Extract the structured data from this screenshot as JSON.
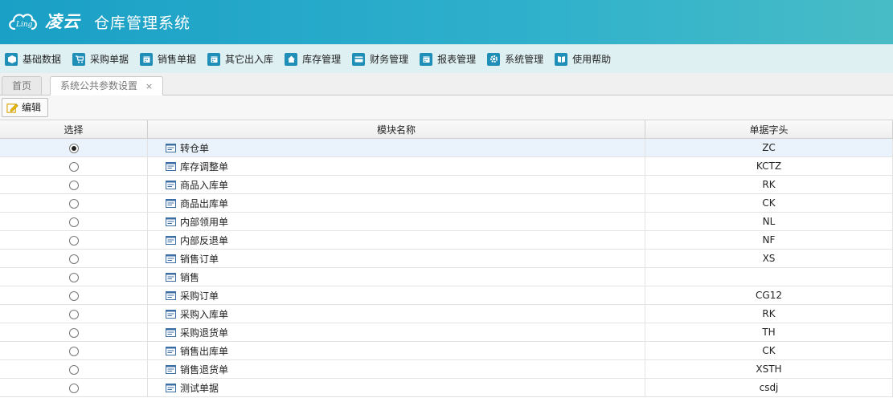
{
  "app": {
    "logo_small": "Ling",
    "brand": "凌云",
    "title": "仓库管理系统"
  },
  "menu": [
    {
      "label": "基础数据",
      "icon": "cube-icon"
    },
    {
      "label": "采购单据",
      "icon": "cart-icon"
    },
    {
      "label": "销售单据",
      "icon": "calendar-icon"
    },
    {
      "label": "其它出入库",
      "icon": "calendar-icon"
    },
    {
      "label": "库存管理",
      "icon": "home-icon"
    },
    {
      "label": "财务管理",
      "icon": "card-icon"
    },
    {
      "label": "报表管理",
      "icon": "calendar-icon"
    },
    {
      "label": "系统管理",
      "icon": "gear-icon"
    },
    {
      "label": "使用帮助",
      "icon": "book-icon"
    }
  ],
  "tabs": {
    "home": "首页",
    "active": "系统公共参数设置",
    "close_glyph": "×"
  },
  "toolbar": {
    "edit_label": "编辑"
  },
  "table": {
    "headers": [
      "选择",
      "模块名称",
      "单据字头"
    ],
    "rows": [
      {
        "name": "转仓单",
        "prefix": "ZC",
        "selected": true
      },
      {
        "name": "库存调整单",
        "prefix": "KCTZ",
        "selected": false
      },
      {
        "name": "商品入库单",
        "prefix": "RK",
        "selected": false
      },
      {
        "name": "商品出库单",
        "prefix": "CK",
        "selected": false
      },
      {
        "name": "内部领用单",
        "prefix": "NL",
        "selected": false
      },
      {
        "name": "内部反退单",
        "prefix": "NF",
        "selected": false
      },
      {
        "name": "销售订单",
        "prefix": "XS",
        "selected": false
      },
      {
        "name": "销售",
        "prefix": "",
        "selected": false
      },
      {
        "name": "采购订单",
        "prefix": "CG12",
        "selected": false
      },
      {
        "name": "采购入库单",
        "prefix": "RK",
        "selected": false
      },
      {
        "name": "采购退货单",
        "prefix": "TH",
        "selected": false
      },
      {
        "name": "销售出库单",
        "prefix": "CK",
        "selected": false
      },
      {
        "name": "销售退货单",
        "prefix": "XSTH",
        "selected": false
      },
      {
        "name": "测试单据",
        "prefix": "csdj",
        "selected": false
      }
    ]
  },
  "colors": {
    "header_start": "#1a9fc6",
    "header_end": "#48bcc6",
    "menubar_bg": "#dff0f3",
    "menu_icon": "#1f8fb8",
    "selected_row": "#eaf2fb"
  }
}
